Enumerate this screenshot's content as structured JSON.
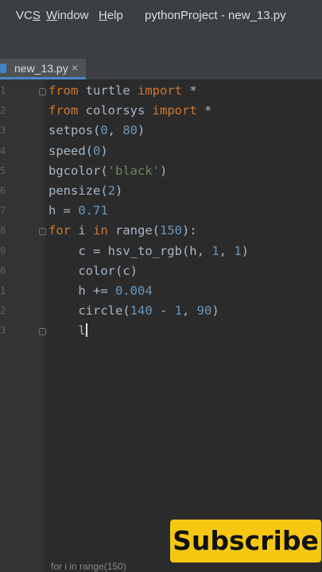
{
  "menubar": {
    "items": [
      {
        "label": "VCS",
        "mnemonic_index": 2
      },
      {
        "label": "Window",
        "mnemonic_index": 0
      },
      {
        "label": "Help",
        "mnemonic_index": 0
      }
    ],
    "project_title": "pythonProject - new_13.py"
  },
  "tab": {
    "label": "new_13.py",
    "close_glyph": "×",
    "icon": "python-file-icon"
  },
  "editor": {
    "line_numbers": [
      "1",
      "2",
      "3",
      "4",
      "5",
      "6",
      "7",
      "8",
      "9",
      "0",
      "1",
      "2",
      "3"
    ],
    "lines": [
      [
        {
          "t": "from",
          "c": "kw"
        },
        {
          "t": " turtle "
        },
        {
          "t": "import",
          "c": "kw"
        },
        {
          "t": " *"
        }
      ],
      [
        {
          "t": "from",
          "c": "kw"
        },
        {
          "t": " colorsys "
        },
        {
          "t": "import",
          "c": "kw"
        },
        {
          "t": " *"
        }
      ],
      [
        {
          "t": "setpos("
        },
        {
          "t": "0",
          "c": "num"
        },
        {
          "t": ", "
        },
        {
          "t": "80",
          "c": "num"
        },
        {
          "t": ")"
        }
      ],
      [
        {
          "t": "speed("
        },
        {
          "t": "0",
          "c": "num"
        },
        {
          "t": ")"
        }
      ],
      [
        {
          "t": "bgcolor("
        },
        {
          "t": "'black'",
          "c": "str"
        },
        {
          "t": ")"
        }
      ],
      [
        {
          "t": "pensize("
        },
        {
          "t": "2",
          "c": "num"
        },
        {
          "t": ")"
        }
      ],
      [
        {
          "t": "h = "
        },
        {
          "t": "0.71",
          "c": "num"
        }
      ],
      [
        {
          "t": "for",
          "c": "kw"
        },
        {
          "t": " i "
        },
        {
          "t": "in",
          "c": "kw"
        },
        {
          "t": " range("
        },
        {
          "t": "150",
          "c": "num"
        },
        {
          "t": "):"
        }
      ],
      [
        {
          "t": "    c = hsv_to_rgb(h, "
        },
        {
          "t": "1",
          "c": "num"
        },
        {
          "t": ", "
        },
        {
          "t": "1",
          "c": "num"
        },
        {
          "t": ")"
        }
      ],
      [
        {
          "t": "    color(c)"
        }
      ],
      [
        {
          "t": "    h += "
        },
        {
          "t": "0.004",
          "c": "num"
        }
      ],
      [
        {
          "t": "    circle("
        },
        {
          "t": "140",
          "c": "num"
        },
        {
          "t": " - "
        },
        {
          "t": "1",
          "c": "num"
        },
        {
          "t": ", "
        },
        {
          "t": "90",
          "c": "num"
        },
        {
          "t": ")"
        }
      ],
      [
        {
          "t": "    l"
        }
      ]
    ],
    "fold_lines": [
      0,
      7,
      12
    ],
    "cursor_line": 12
  },
  "overlay": {
    "subscribe_label": "Subscribe",
    "bottom_hint": "for i in range(150)"
  },
  "colors": {
    "keyword": "#cc7832",
    "number": "#6897bb",
    "string": "#6a8759",
    "text": "#a9b7c6",
    "accent": "#f6c812"
  }
}
